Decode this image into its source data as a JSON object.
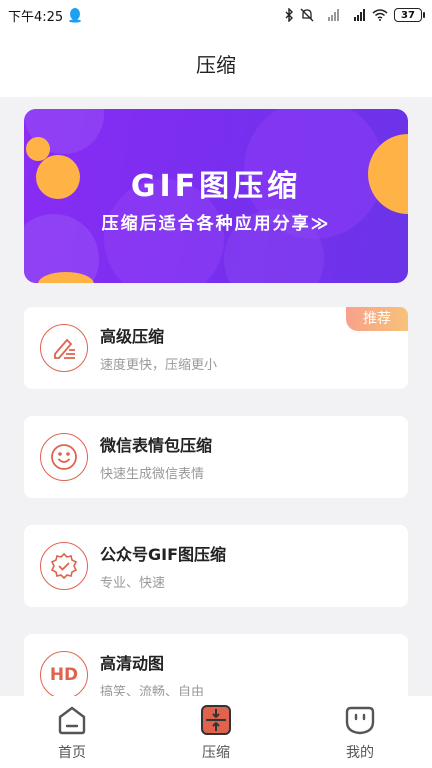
{
  "status": {
    "time": "下午4:25",
    "battery": "37"
  },
  "header": {
    "title": "压缩"
  },
  "banner": {
    "title": "GIF图压缩",
    "subtitle": "压缩后适合各种应用分享≫"
  },
  "features": [
    {
      "title": "高级压缩",
      "desc": "速度更快，压缩更小",
      "badge": "推荐",
      "icon": "edit-lines-icon"
    },
    {
      "title": "微信表情包压缩",
      "desc": "快速生成微信表情",
      "icon": "smiley-icon"
    },
    {
      "title": "公众号GIF图压缩",
      "desc": "专业、快速",
      "icon": "verified-badge-icon"
    },
    {
      "title": "高清动图",
      "desc": "搞笑、流畅、自由",
      "icon_text": "HD",
      "icon": "hd-icon"
    }
  ],
  "tabs": [
    {
      "label": "首页",
      "icon": "home-icon"
    },
    {
      "label": "压缩",
      "icon": "compress-icon",
      "active": true
    },
    {
      "label": "我的",
      "icon": "profile-icon"
    }
  ],
  "colors": {
    "accent": "#e0634f",
    "banner_purple": "#7a2ef0",
    "banner_orange": "#ffb347"
  }
}
